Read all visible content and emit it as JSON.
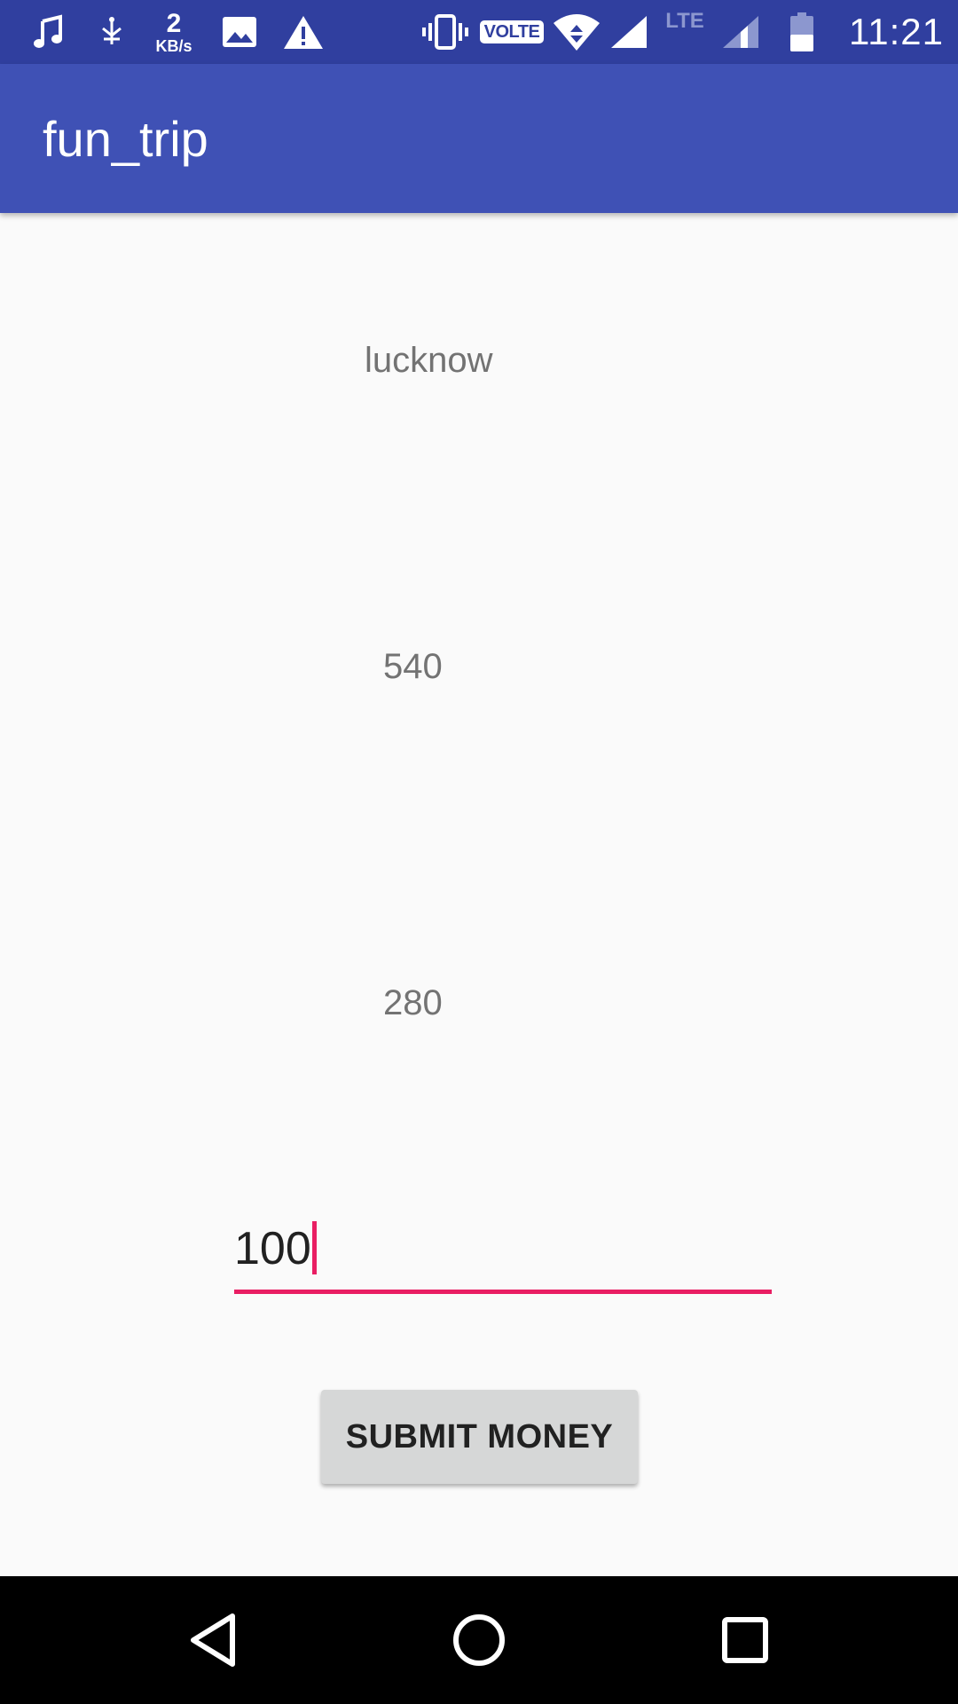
{
  "status_bar": {
    "icons": [
      "music-note-icon",
      "usb-debug-icon",
      "image-icon",
      "warning-icon",
      "vibrate-icon",
      "wifi-icon",
      "signal-icon",
      "battery-icon"
    ],
    "data_rate_value": "2",
    "data_rate_unit": "KB/s",
    "volte_label": "VOLTE",
    "lte_label": "LTE",
    "time": "11:21",
    "background_color": "#303f9f"
  },
  "app_bar": {
    "title": "fun_trip",
    "background_color": "#3f51b5"
  },
  "content": {
    "city": "lucknow",
    "value_1": "540",
    "value_2": "280",
    "money_input": {
      "value": "100",
      "accent_color": "#e91e63"
    },
    "submit_label": "SUBMIT MONEY"
  },
  "nav_bar": {
    "icons": [
      "back-icon",
      "home-icon",
      "recents-icon"
    ]
  }
}
